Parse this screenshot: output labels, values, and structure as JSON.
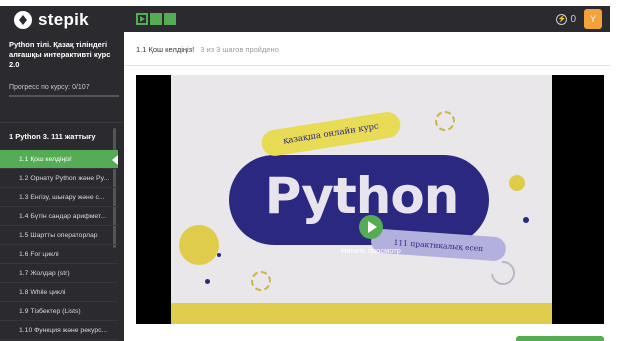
{
  "header": {
    "logo_text": "stepik",
    "energy_count": "0",
    "avatar_letter": "Y",
    "step_count": 3
  },
  "sidebar": {
    "course_title": "Python тілі. Қазақ тіліндегі алғашқы интерактивті курс 2.0",
    "progress_label": "Прогресс по курсу: 0/107",
    "progress_fraction": 0,
    "section_title": "1  Python 3. 111 жаттығу",
    "lessons": [
      {
        "label": "1.1  Қош келдіңіз!"
      },
      {
        "label": "1.2  Орнату Python және Py..."
      },
      {
        "label": "1.3  Енгізу, шығару және с..."
      },
      {
        "label": "1.4  Бүтін сандар арифмет..."
      },
      {
        "label": "1.5  Шартты операторлар"
      },
      {
        "label": "1.6  For циклі"
      },
      {
        "label": "1.7  Жолдар (str)"
      },
      {
        "label": "1.8  While циклі"
      },
      {
        "label": "1.9  Тізбектер (Lists)"
      },
      {
        "label": "1.10  Функция және рекурс..."
      }
    ]
  },
  "main": {
    "lesson_title": "1.1 Қош келдіңіз!",
    "steps_status": "3 из 3 шагов пройдено",
    "video": {
      "tag_top": "қазақша онлайн курс",
      "headline": "Python",
      "tag_bottom": "111 практикалық есеп",
      "play_label": "Начать просмотр"
    }
  },
  "colors": {
    "accent_green": "#54ad54",
    "dark_bg": "#2b2b2f",
    "navy": "#2a2880",
    "yellow": "#dfcc4a"
  }
}
